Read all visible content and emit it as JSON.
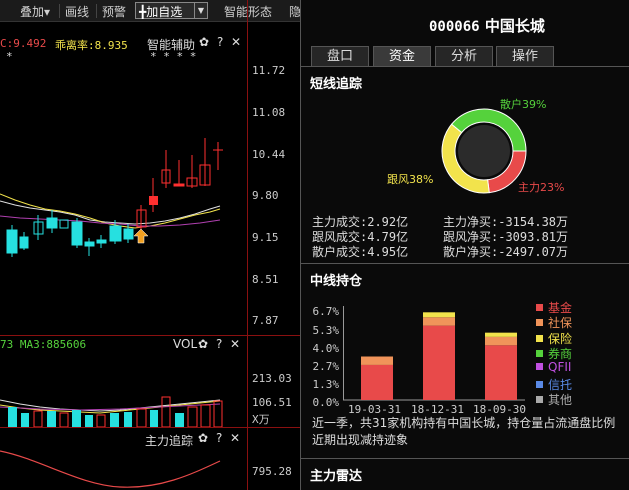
{
  "toolbar": {
    "items": [
      "叠加▾",
      "画线",
      "预警"
    ],
    "add_label": "╋加自选",
    "right_items": [
      "智能形态",
      "隐"
    ]
  },
  "kline": {
    "indicator_left": "C:9.492",
    "indicator_right": "乖离率:8.935",
    "assist_title": "智能辅助",
    "stars": "* * * *",
    "star_left": "*",
    "y_ticks": [
      "11.72",
      "11.08",
      "10.44",
      "9.80",
      "9.15",
      "8.51",
      "7.87"
    ]
  },
  "volume": {
    "header": "73  MA3:885606",
    "title": "VOL",
    "y_ticks": [
      "213.03",
      "106.51"
    ],
    "unit": "X万"
  },
  "tracker": {
    "title": "主力追踪",
    "y_tick": "795.28"
  },
  "stock": {
    "code": "000066",
    "name": "中国长城"
  },
  "tabs": [
    "盘口",
    "资金",
    "分析",
    "操作"
  ],
  "short_term": {
    "title": "短线追踪",
    "donut": {
      "retail_label": "散户39%",
      "follow_label": "跟风38%",
      "main_label": "主力23%",
      "retail_pct": 39,
      "follow_pct": 38,
      "main_pct": 23,
      "retail_color": "#55d23c",
      "follow_color": "#f2e34c",
      "main_color": "#e84a4a"
    },
    "stats": [
      [
        "主力成交:2.92亿",
        "主力净买:-3154.38万"
      ],
      [
        "跟风成交:4.79亿",
        "跟风净买:-3093.81万"
      ],
      [
        "散户成交:4.95亿",
        "散户净买:-2497.07万"
      ]
    ]
  },
  "mid_term": {
    "title": "中线持仓",
    "legend": [
      {
        "label": "基金",
        "color": "#e84a4a"
      },
      {
        "label": "社保",
        "color": "#f0945a"
      },
      {
        "label": "保险",
        "color": "#f2e34c"
      },
      {
        "label": "券商",
        "color": "#55d23c"
      },
      {
        "label": "QFII",
        "color": "#c050e0"
      },
      {
        "label": "信托",
        "color": "#5a8ae6"
      },
      {
        "label": "其他",
        "color": "#aaaaaa"
      }
    ],
    "note_line1": "近一季，共31家机构持有中国长城，持仓量占流通盘比例",
    "note_line2": "近期出现减持迹象"
  },
  "chart_data": {
    "type": "bar",
    "stacked": true,
    "categories": [
      "19-03-31",
      "18-12-31",
      "18-09-30"
    ],
    "y_tick_labels": [
      "6.7%",
      "5.3%",
      "4.0%",
      "2.7%",
      "1.3%",
      "0.0%"
    ],
    "ylim": [
      0,
      6.7
    ],
    "series": [
      {
        "name": "基金",
        "color": "#e84a4a",
        "values": [
          2.5,
          5.3,
          3.9
        ]
      },
      {
        "name": "社保",
        "color": "#f0945a",
        "values": [
          0.6,
          0.6,
          0.6
        ]
      },
      {
        "name": "保险",
        "color": "#f2e34c",
        "values": [
          0.0,
          0.35,
          0.3
        ]
      }
    ]
  },
  "radar": {
    "title": "主力雷达"
  }
}
